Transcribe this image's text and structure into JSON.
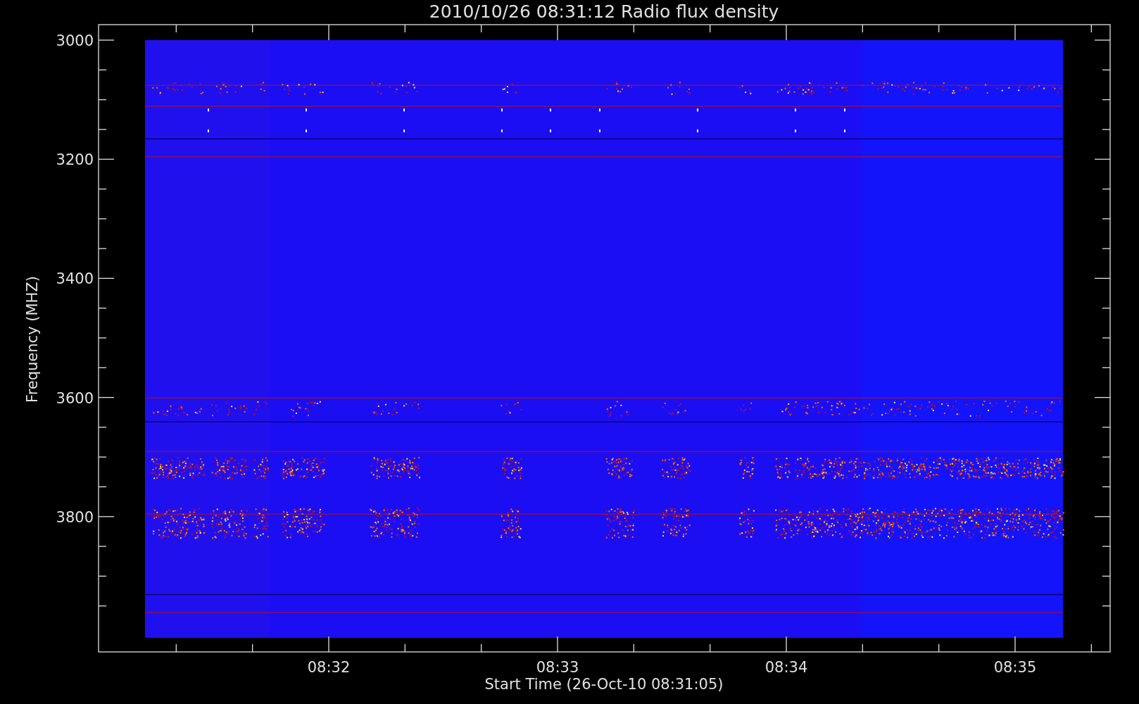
{
  "title": "2010/10/26 08:31:12 Radio flux density",
  "y_axis": {
    "label": "Frequency (MHZ)",
    "ticks": [
      "3000",
      "3200",
      "3400",
      "3600",
      "3800"
    ]
  },
  "x_axis": {
    "label": "Start Time (26-Oct-10 08:31:05)",
    "ticks": [
      "08:32",
      "08:33",
      "08:34",
      "08:35"
    ]
  }
}
